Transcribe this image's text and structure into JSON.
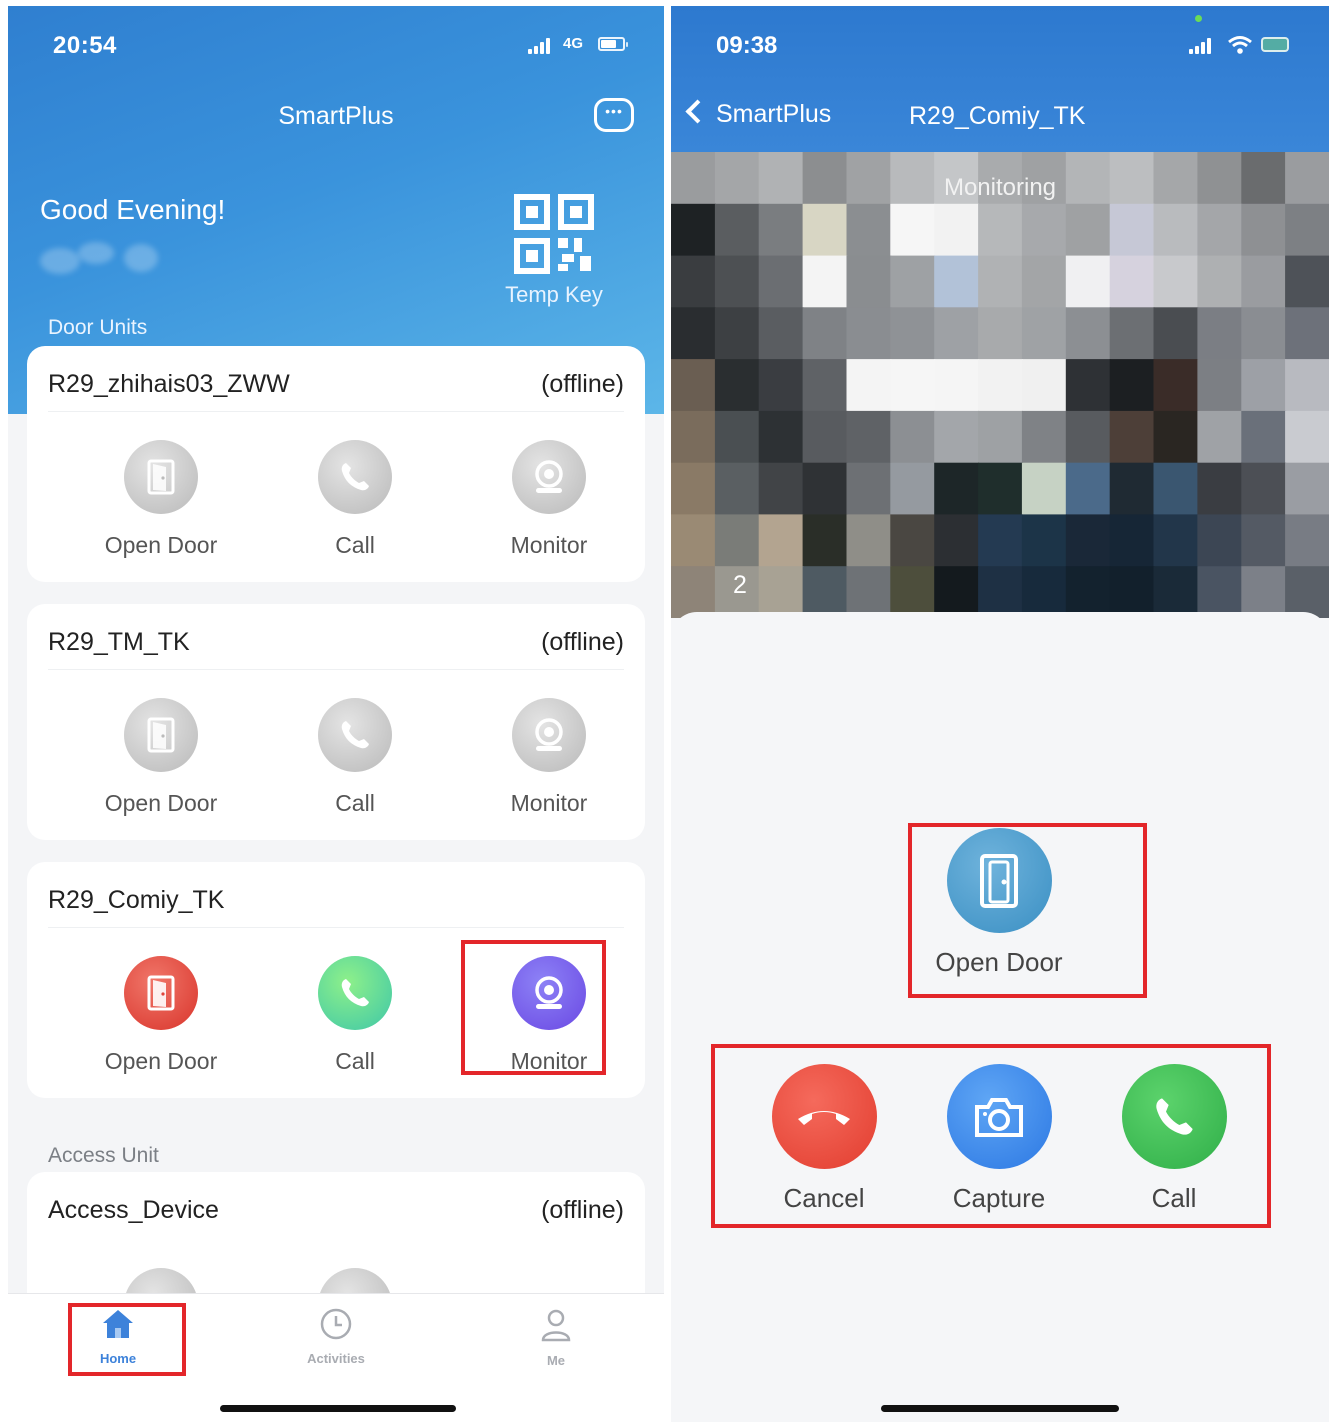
{
  "left_screen": {
    "status_bar": {
      "time": "20:54",
      "network": "4G"
    },
    "header": {
      "title": "SmartPlus",
      "chat_icon": "chat-bubble-icon"
    },
    "greeting": "Good Evening!",
    "temp_key": {
      "label": "Temp Key",
      "icon": "qr-code-icon"
    },
    "sections": {
      "door_units": "Door Units",
      "access_unit": "Access Unit"
    },
    "door_units": [
      {
        "name": "R29_zhihais03_ZWW",
        "status": "(offline)",
        "actions": [
          {
            "label": "Open Door",
            "icon": "door-icon",
            "color": "#b9b9b9"
          },
          {
            "label": "Call",
            "icon": "phone-icon",
            "color": "#b9b9b9"
          },
          {
            "label": "Monitor",
            "icon": "camera-icon",
            "color": "#b9b9b9"
          }
        ]
      },
      {
        "name": "R29_TM_TK",
        "status": "(offline)",
        "actions": [
          {
            "label": "Open Door",
            "icon": "door-icon",
            "color": "#b9b9b9"
          },
          {
            "label": "Call",
            "icon": "phone-icon",
            "color": "#b9b9b9"
          },
          {
            "label": "Monitor",
            "icon": "camera-icon",
            "color": "#b9b9b9"
          }
        ]
      },
      {
        "name": "R29_Comiy_TK",
        "status": "",
        "actions": [
          {
            "label": "Open Door",
            "icon": "door-icon",
            "color": "#e0453b"
          },
          {
            "label": "Call",
            "icon": "phone-icon",
            "color": "#4fd39a"
          },
          {
            "label": "Monitor",
            "icon": "camera-icon",
            "color": "#6f55e8"
          }
        ]
      }
    ],
    "access_units": [
      {
        "name": "Access_Device",
        "status": "(offline)"
      }
    ],
    "tab_bar": [
      {
        "label": "Home",
        "icon": "home-icon",
        "active": true
      },
      {
        "label": "Activities",
        "icon": "clock-icon",
        "active": false
      },
      {
        "label": "Me",
        "icon": "person-icon",
        "active": false
      }
    ]
  },
  "right_screen": {
    "status_bar": {
      "time": "09:38"
    },
    "header": {
      "back_label": "SmartPlus",
      "device_name": "R29_Comiy_TK"
    },
    "video": {
      "overlay_label": "Monitoring",
      "channel": "2"
    },
    "open_door": {
      "label": "Open Door",
      "icon": "door-icon",
      "color": "#4a9ccd"
    },
    "controls": [
      {
        "label": "Cancel",
        "icon": "hang-up-icon",
        "color": "#e84a3d"
      },
      {
        "label": "Capture",
        "icon": "camera-icon",
        "color": "#3d8be9"
      },
      {
        "label": "Call",
        "icon": "phone-icon",
        "color": "#3dbb55"
      }
    ]
  },
  "highlight_color": "#e3262a"
}
